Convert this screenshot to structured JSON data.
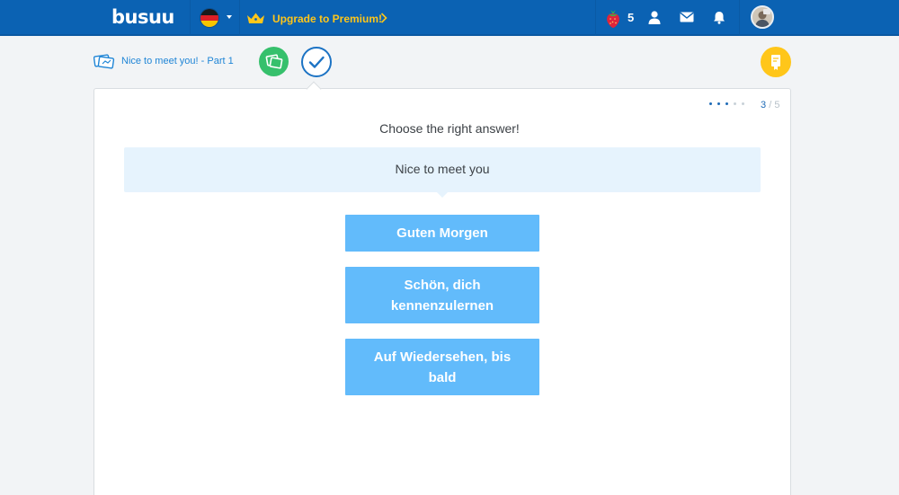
{
  "header": {
    "logo": "busuu",
    "language_flag": "germany-flag",
    "upgrade_label": "Upgrade to Premium!",
    "berries_count": "5",
    "icons": [
      "strawberry-icon",
      "profile-icon",
      "mail-icon",
      "bell-icon",
      "avatar"
    ]
  },
  "lesson": {
    "title": "Nice to meet you! - Part 1"
  },
  "progress": {
    "current": "3",
    "separator": "/",
    "total": "5",
    "dots_filled": 3,
    "dots_total": 5
  },
  "exercise": {
    "instruction": "Choose the right answer!",
    "prompt": "Nice to meet you",
    "options": [
      {
        "label": "Guten Morgen"
      },
      {
        "label": "Schön, dich kennenzulernen"
      },
      {
        "label": "Auf Wiedersehen, bis bald"
      }
    ]
  },
  "colors": {
    "header_bg": "#0b62b3",
    "accent_yellow": "#ffc61a",
    "option_bg": "#62bbfb",
    "prompt_bg": "#e6f3fd",
    "step_green": "#36c06c"
  }
}
